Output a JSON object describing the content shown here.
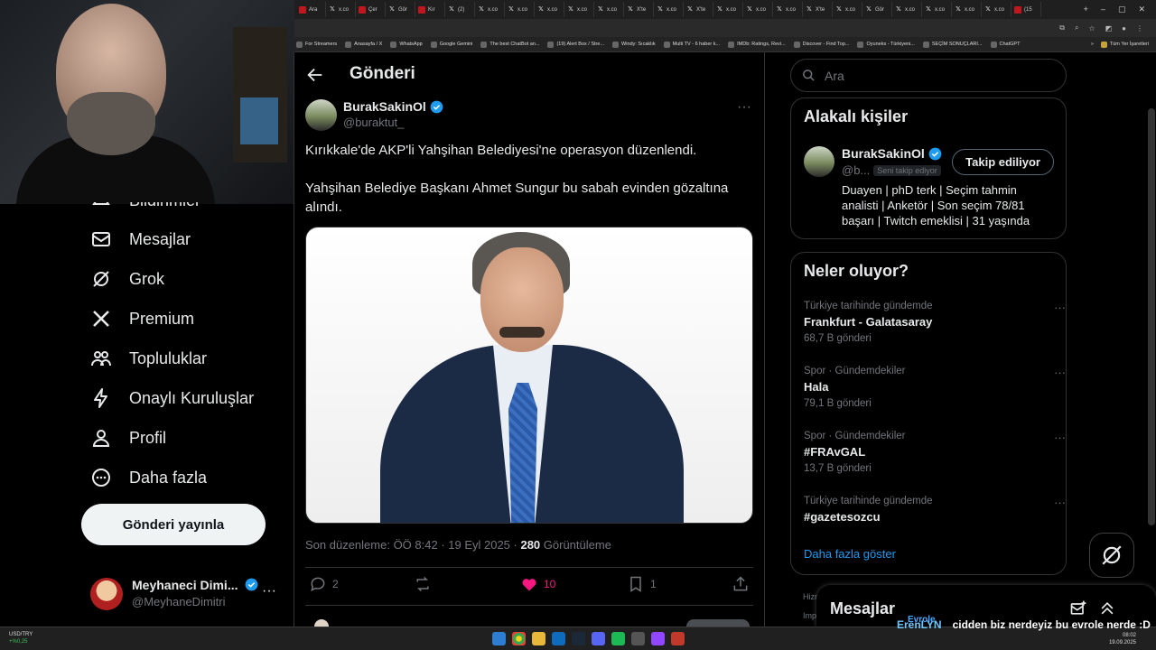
{
  "browser": {
    "tabs": [
      {
        "icon": "red",
        "label": "Ara"
      },
      {
        "icon": "x",
        "label": "x.co"
      },
      {
        "icon": "red",
        "label": "Çer"
      },
      {
        "icon": "x",
        "label": "Gör"
      },
      {
        "icon": "red",
        "label": "Kır"
      },
      {
        "icon": "x",
        "label": "(2)"
      },
      {
        "icon": "x",
        "label": "x.co"
      },
      {
        "icon": "x",
        "label": "x.co"
      },
      {
        "icon": "x",
        "label": "x.co"
      },
      {
        "icon": "x",
        "label": "x.co"
      },
      {
        "icon": "x",
        "label": "x.co"
      },
      {
        "icon": "x",
        "label": "X'te"
      },
      {
        "icon": "x",
        "label": "x.co"
      },
      {
        "icon": "x",
        "label": "X'te"
      },
      {
        "icon": "x",
        "label": "x.co"
      },
      {
        "icon": "x",
        "label": "x.co"
      },
      {
        "icon": "x",
        "label": "x.co"
      },
      {
        "icon": "x",
        "label": "X'te"
      },
      {
        "icon": "x",
        "label": "x.co"
      },
      {
        "icon": "x",
        "label": "Gör"
      },
      {
        "icon": "x",
        "label": "x.co"
      },
      {
        "icon": "x",
        "label": "x.co"
      },
      {
        "icon": "x",
        "label": "x.co"
      },
      {
        "icon": "x",
        "label": "x.co"
      },
      {
        "icon": "red",
        "label": "(15"
      }
    ],
    "bookmarks": [
      "For Streamers",
      "Anasayfa / X",
      "WhatsApp",
      "Google Gemini",
      "The best ChatBot an...",
      "(19) Alert Box / Stre...",
      "Windy: Sıcaklık",
      "Multi TV - 6 haber k...",
      "IMDb: Ratings, Revi...",
      "Discover - Find Top...",
      "Oyuneks - Türkiyeni...",
      "SEÇİM SONUÇLARI...",
      "ChatGPT"
    ],
    "bookmarks_overflow": "»",
    "bookmarks_folder": "Tüm Yer İşaretleri"
  },
  "nav": {
    "partial_item": "Bildirimler",
    "items": [
      {
        "label": "Mesajlar",
        "icon": "mail-icon"
      },
      {
        "label": "Grok",
        "icon": "grok-icon"
      },
      {
        "label": "Premium",
        "icon": "x-logo-icon"
      },
      {
        "label": "Topluluklar",
        "icon": "people-icon"
      },
      {
        "label": "Onaylı Kuruluşlar",
        "icon": "lightning-icon"
      },
      {
        "label": "Profil",
        "icon": "person-icon"
      },
      {
        "label": "Daha fazla",
        "icon": "more-circle-icon"
      }
    ],
    "post_button": "Gönderi yayınla",
    "account": {
      "name": "Meyhaneci Dimi...",
      "handle": "@MeyhaneDimitri",
      "more": "···"
    }
  },
  "main": {
    "title": "Gönderi",
    "author": {
      "name": "BurakSakinOl",
      "handle": "@buraktut_"
    },
    "more": "···",
    "text": [
      "Kırıkkale'de AKP'li Yahşihan Belediyesi'ne operasyon düzenlendi.",
      "Yahşihan Belediye Başkanı Ahmet Sungur bu sabah evinden gözaltına alındı."
    ],
    "meta": {
      "edited": "Son düzenleme: ÖÖ 8:42 · 19 Eyl 2025 · ",
      "views": "280",
      "views_label": " Görüntüleme"
    },
    "actions": {
      "replies": "2",
      "reposts": "",
      "likes": "10",
      "bookmarks": "1"
    }
  },
  "right": {
    "search_placeholder": "Ara",
    "related": {
      "title": "Alakalı kişiler",
      "name": "BurakSakinOl",
      "handle": "@b...",
      "follows_you": "Seni takip ediyor",
      "follow_button": "Takip ediliyor",
      "bio": "Duayen | phD terk | Seçim tahmin analisti | Anketör | Son seçim 78/81 başarı | Twitch emeklisi | 31 yaşında"
    },
    "trends": {
      "title": "Neler oluyor?",
      "items": [
        {
          "context": "Türkiye tarihinde gündemde",
          "title": "Frankfurt - Galatasaray",
          "count": "68,7 B gönderi"
        },
        {
          "context": "Spor · Gündemdekiler",
          "title": "Hala",
          "count": "79,1 B gönderi"
        },
        {
          "context": "Spor · Gündemdekiler",
          "title": "#FRAvGAL",
          "count": "13,7 B gönderi"
        },
        {
          "context": "Türkiye tarihinde gündemde",
          "title": "#gazetesozcu",
          "count": ""
        }
      ],
      "show_more": "Daha fazla göster"
    },
    "footer": [
      "Hizm",
      "Impr"
    ],
    "messages_title": "Mesajlar"
  },
  "taskbar": {
    "ticker_label": "USD/TRY",
    "ticker_change": "+%0,25",
    "chat_user_small": "Evrole",
    "chat_user": "ErenLYN",
    "chat_text": "cidden biz nerdeyiz bu evrole nerde :D",
    "time": "08:02",
    "date": "19.09.2025"
  },
  "colors": {
    "accent": "#1d9bf0",
    "like": "#f91880",
    "bg": "#000000",
    "border": "#2f3336",
    "muted": "#71767b"
  }
}
